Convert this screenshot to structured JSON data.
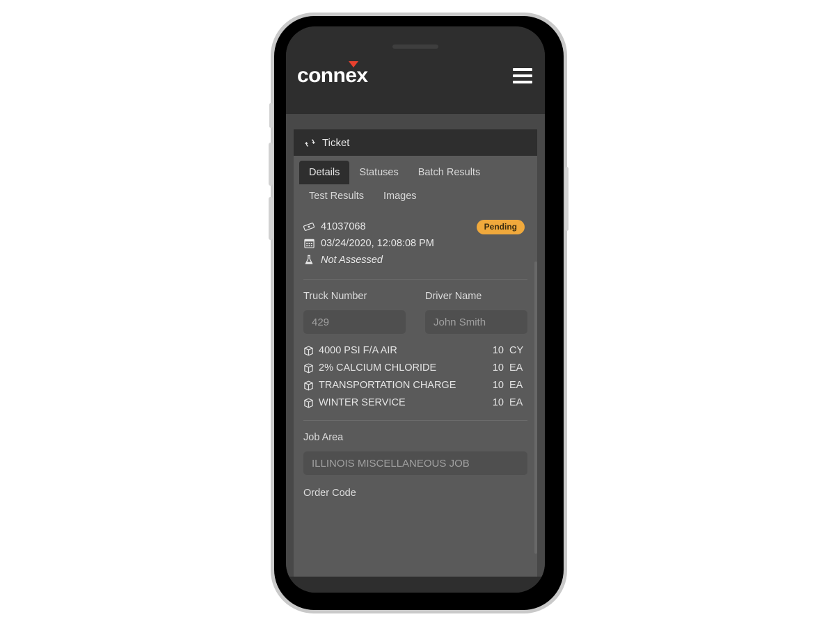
{
  "app": {
    "logo_text": "connex",
    "menu_icon": "hamburger-icon"
  },
  "card": {
    "header_icon": "refresh-icon",
    "header_title": "Ticket"
  },
  "tabs": [
    {
      "label": "Details",
      "active": true
    },
    {
      "label": "Statuses",
      "active": false
    },
    {
      "label": "Batch Results",
      "active": false
    },
    {
      "label": "Test Results",
      "active": false
    },
    {
      "label": "Images",
      "active": false
    }
  ],
  "ticket": {
    "number": "41037068",
    "number_icon": "ticket-icon",
    "datetime": "03/24/2020, 12:08:08 PM",
    "datetime_icon": "calendar-icon",
    "assessment": "Not Assessed",
    "assessment_icon": "flask-icon",
    "status_badge": "Pending",
    "status_badge_color": "#f0a93c"
  },
  "fields": {
    "truck_number_label": "Truck Number",
    "truck_number_value": "",
    "truck_number_placeholder": "429",
    "driver_name_label": "Driver Name",
    "driver_name_value": "",
    "driver_name_placeholder": "John Smith",
    "job_area_label": "Job Area",
    "job_area_value": "",
    "job_area_placeholder": "ILLINOIS MISCELLANEOUS JOB",
    "order_code_label": "Order Code"
  },
  "line_items": [
    {
      "icon": "box-icon",
      "description": "4000 PSI F/A AIR",
      "quantity": "10",
      "uom": "CY"
    },
    {
      "icon": "box-icon",
      "description": "2% CALCIUM CHLORIDE",
      "quantity": "10",
      "uom": "EA"
    },
    {
      "icon": "box-icon",
      "description": "TRANSPORTATION CHARGE",
      "quantity": "10",
      "uom": "EA"
    },
    {
      "icon": "box-icon",
      "description": "WINTER SERVICE",
      "quantity": "10",
      "uom": "EA"
    }
  ]
}
